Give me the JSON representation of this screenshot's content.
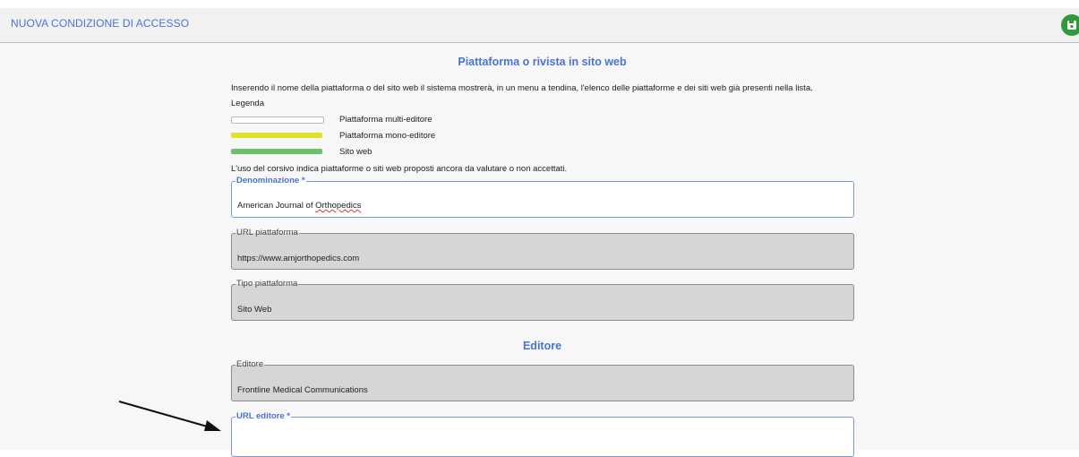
{
  "header": {
    "title": "NUOVA CONDIZIONE DI ACCESSO",
    "save_icon": "save-icon",
    "accent": "#4a73d6",
    "save_color": "#2e9a3a"
  },
  "sections": {
    "platform_title": "Piattaforma o rivista in sito web",
    "editor_title": "Editore"
  },
  "intro": "Inserendo il nome della piattaforma o del sito web il sistema mostrerà, in un menu a tendina, l'elenco delle piattaforme e dei siti web già presenti nella lista.",
  "legend": {
    "title": "Legenda",
    "items": [
      {
        "label": "Piattaforma multi-editore",
        "color": "#ffffff"
      },
      {
        "label": "Piattaforma mono-editore",
        "color": "#e0e22a"
      },
      {
        "label": "Sito web",
        "color": "#6cc26c"
      }
    ]
  },
  "italic_note": "L'uso del corsivo indica piattaforme o siti web proposti ancora da valutare o non accettati.",
  "fields": {
    "denominazione": {
      "label": "Denominazione *",
      "value_prefix": "American Journal of ",
      "value_word": "Orthopedics"
    },
    "url_piattaforma": {
      "label": "URL piattaforma",
      "value": "https://www.amjorthopedics.com"
    },
    "tipo_piattaforma": {
      "label": "Tipo piattaforma",
      "value": "Sito Web"
    },
    "editore": {
      "label": "Editore",
      "value": "Frontline Medical Communications"
    },
    "url_editore": {
      "label": "URL editore *",
      "value": ""
    }
  },
  "annotation": {
    "arrow_icon": "arrow-annotation-icon"
  }
}
